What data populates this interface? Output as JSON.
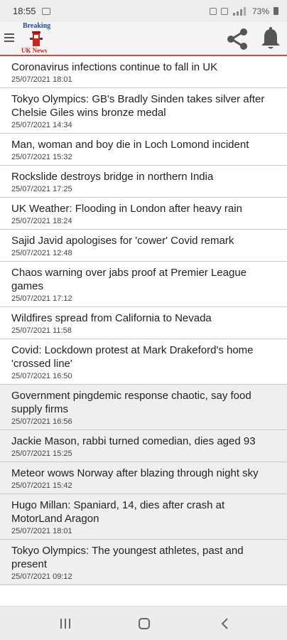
{
  "status_bar": {
    "time": "18:55",
    "battery": "73%"
  },
  "app": {
    "logo_top": "Breaking",
    "logo_bottom": "UK News"
  },
  "icons": {
    "menu": "hamburger-icon",
    "share": "share-icon",
    "bell": "bell-icon"
  },
  "colors": {
    "accent": "#d84a3a",
    "logo_blue": "#1f49b6",
    "logo_red": "#d0201a"
  },
  "news": [
    {
      "title": "Coronavirus infections continue to fall in UK",
      "date": "25/07/2021 18:01"
    },
    {
      "title": "Tokyo Olympics: GB's Bradly Sinden takes silver after Chelsie Giles wins bronze medal",
      "date": "25/07/2021 14:34"
    },
    {
      "title": "Man, woman and boy die in Loch Lomond incident",
      "date": "25/07/2021 15:32"
    },
    {
      "title": "Rockslide destroys bridge in northern India",
      "date": "25/07/2021 17:25"
    },
    {
      "title": "UK Weather: Flooding in London after heavy rain",
      "date": "25/07/2021 18:24"
    },
    {
      "title": "Sajid Javid apologises for 'cower' Covid remark",
      "date": "25/07/2021 12:48"
    },
    {
      "title": "Chaos warning over jabs proof at Premier League games",
      "date": "25/07/2021 17:12"
    },
    {
      "title": "Wildfires spread from California to Nevada",
      "date": "25/07/2021 11:58"
    },
    {
      "title": "Covid: Lockdown protest at Mark Drakeford's home 'crossed line'",
      "date": "25/07/2021 16:50"
    },
    {
      "title": "Government pingdemic response chaotic, say food supply firms",
      "date": "25/07/2021 16:56"
    },
    {
      "title": "Jackie Mason, rabbi turned comedian, dies aged 93",
      "date": "25/07/2021 15:25"
    },
    {
      "title": "Meteor wows Norway after blazing through night sky",
      "date": "25/07/2021 15:42"
    },
    {
      "title": "Hugo Millan: Spaniard, 14, dies after crash at MotorLand Aragon",
      "date": "25/07/2021 18:01"
    },
    {
      "title": "Tokyo Olympics: The youngest athletes, past and present",
      "date": "25/07/2021 09:12"
    }
  ]
}
